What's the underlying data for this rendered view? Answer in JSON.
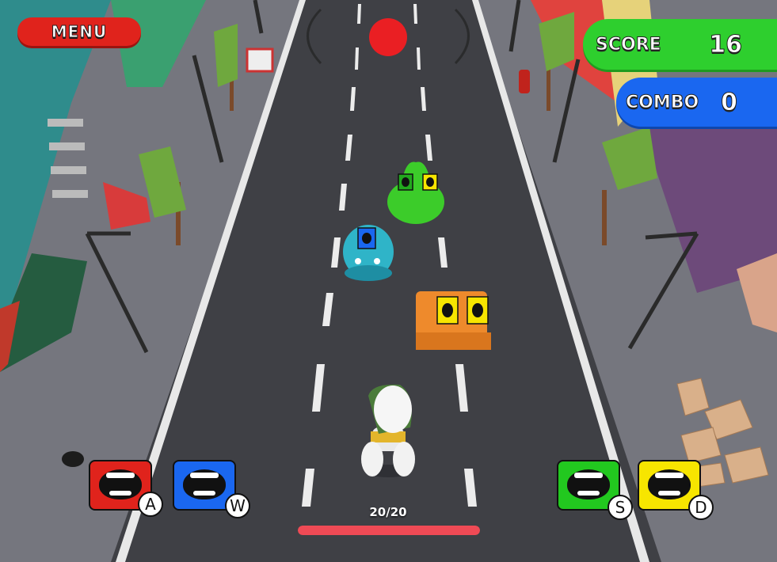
{
  "hud": {
    "menu_label": "MENU",
    "score_label": "SCORE",
    "score_value": "16",
    "combo_label": "COMBO",
    "combo_value": "0",
    "health_text": "20/20",
    "health_fraction": 1.0
  },
  "mouth_buttons": [
    {
      "key": "A",
      "color": "#e0231c",
      "name": "red"
    },
    {
      "key": "W",
      "color": "#1a67f0",
      "name": "blue"
    },
    {
      "key": "S",
      "color": "#22c81f",
      "name": "green"
    },
    {
      "key": "D",
      "color": "#f7e500",
      "name": "yellow"
    }
  ],
  "colors": {
    "road": "#3f4045",
    "sidewalk": "#75767e",
    "score_panel": "#2ecf2e",
    "combo_panel": "#1a67f0",
    "health_bar": "#ef4a55",
    "record_button": "#ea1f23"
  }
}
